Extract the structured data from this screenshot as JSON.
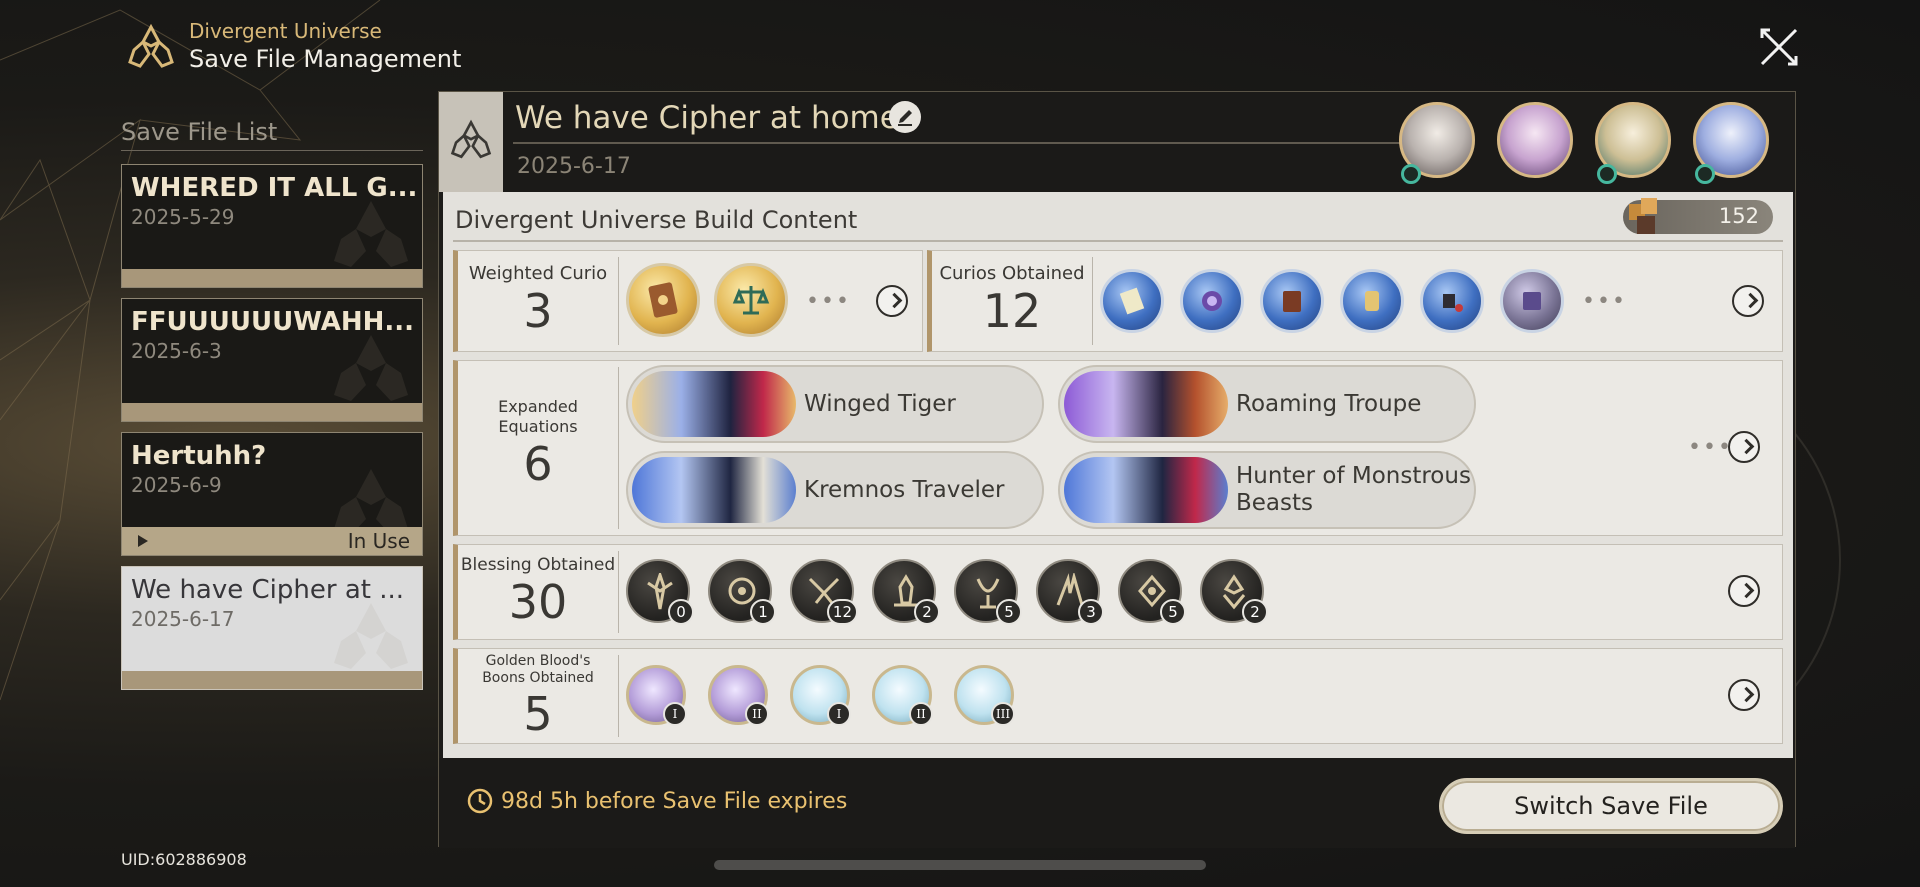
{
  "header": {
    "subtitle": "Divergent Universe",
    "title": "Save File Management"
  },
  "save_list": {
    "title": "Save File List",
    "items": [
      {
        "name": "WHERED IT ALL G...",
        "date": "2025-5-29"
      },
      {
        "name": "FFUUUUUUWAHH...",
        "date": "2025-6-3"
      },
      {
        "name": "Hertuhh?",
        "date": "2025-6-9",
        "status": "In Use"
      },
      {
        "name": "We have Cipher at ...",
        "date": "2025-6-17"
      }
    ]
  },
  "uid": "UID:602886908",
  "current_save": {
    "name": "We have Cipher at home:",
    "date": "2025-6-17"
  },
  "build": {
    "title": "Divergent Universe Build Content",
    "currency_value": "152",
    "weighted_curio": {
      "label": "Weighted Curio",
      "count": "3"
    },
    "curios_obtained": {
      "label": "Curios Obtained",
      "count": "12"
    },
    "expanded_equations": {
      "label": "Expanded Equations",
      "count": "6",
      "items": [
        "Winged Tiger",
        "Roaming Troupe",
        "Kremnos Traveler",
        "Hunter of Monstrous Beasts"
      ]
    },
    "blessing_obtained": {
      "label": "Blessing Obtained",
      "count": "30",
      "levels": [
        "0",
        "1",
        "12",
        "2",
        "5",
        "3",
        "5",
        "2"
      ]
    },
    "golden_boons": {
      "label": "Golden Blood's Boons Obtained",
      "count": "5",
      "ranks": [
        "I",
        "II",
        "I",
        "II",
        "III"
      ]
    }
  },
  "footer": {
    "expiry_text": "98d 5h  before Save File expires",
    "switch_button": "Switch Save File"
  },
  "colors": {
    "accent_gold": "#d8b878",
    "expiry_gold": "#e9c170",
    "row_accent": "#b0956a",
    "panel_dark": "#1b1a18",
    "panel_light": "#e3e1dc"
  }
}
